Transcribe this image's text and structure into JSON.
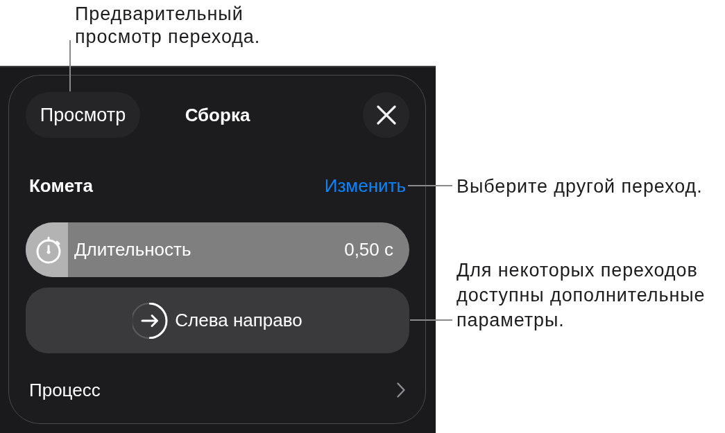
{
  "callouts": [
    {
      "text": "Предварительный просмотр перехода."
    },
    {
      "text": "Выберите другой переход."
    },
    {
      "text": "Для некоторых переходов доступны дополнительные параметры."
    }
  ],
  "panel": {
    "preview_button": "Просмотр",
    "title": "Сборка",
    "transition": {
      "name": "Комета",
      "change_link": "Изменить"
    },
    "duration": {
      "label": "Длительность",
      "value": "0,50 с",
      "level": 0.11
    },
    "direction_button": "Слева направо",
    "rows": [
      {
        "label": "Процесс"
      }
    ]
  }
}
